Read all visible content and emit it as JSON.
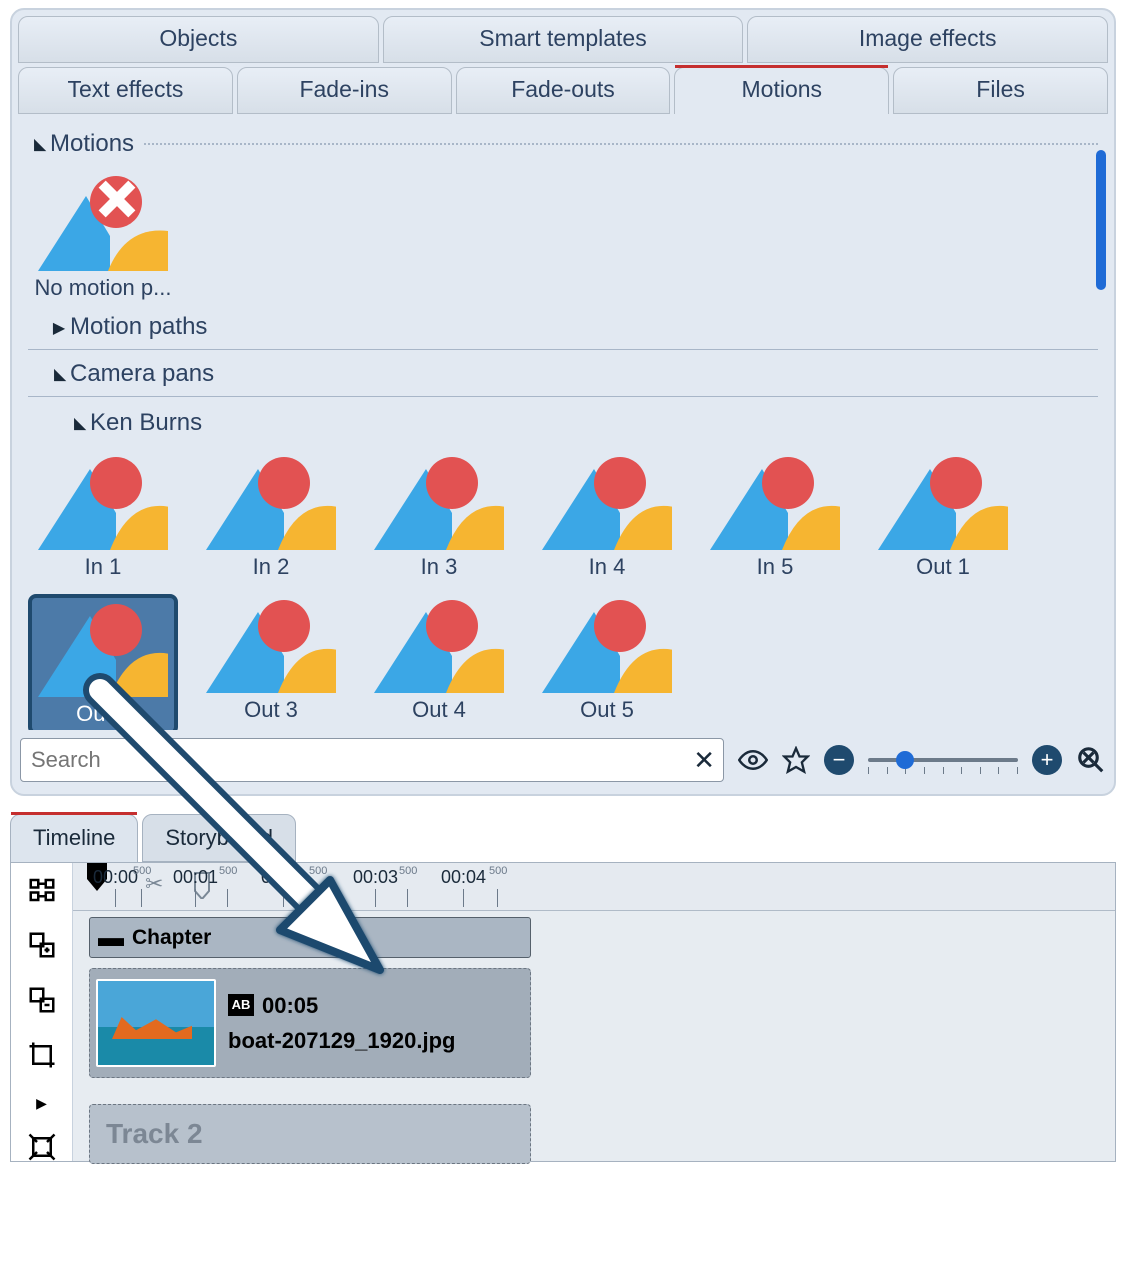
{
  "top_tabs_row1": [
    "Objects",
    "Smart templates",
    "Image effects"
  ],
  "top_tabs_row2": [
    "Text effects",
    "Fade-ins",
    "Fade-outs",
    "Motions",
    "Files"
  ],
  "active_tab_row2_index": 3,
  "sections": {
    "motions": {
      "label": "Motions",
      "expanded": true
    },
    "no_motion": {
      "label": "No motion p..."
    },
    "motion_paths": {
      "label": "Motion paths",
      "expanded": false
    },
    "camera_pans": {
      "label": "Camera pans",
      "expanded": true
    },
    "ken_burns": {
      "label": "Ken Burns",
      "expanded": true
    }
  },
  "ken_burns_items": [
    "In 1",
    "In 2",
    "In 3",
    "In 4",
    "In 5",
    "Out 1",
    "Out 2",
    "Out 3",
    "Out 4",
    "Out 5"
  ],
  "selected_item": "Out 2",
  "search": {
    "placeholder": "Search",
    "value": ""
  },
  "lower_tabs": [
    "Timeline",
    "Storyboard"
  ],
  "active_lower_tab_index": 0,
  "ruler_labels": [
    {
      "text": "00:00",
      "pos": 20
    },
    {
      "text": "500",
      "pos": 60,
      "minor": true
    },
    {
      "text": "00:01",
      "pos": 100
    },
    {
      "text": "500",
      "pos": 146,
      "minor": true
    },
    {
      "text": "00:02",
      "pos": 188
    },
    {
      "text": "500",
      "pos": 236,
      "minor": true
    },
    {
      "text": "00:03",
      "pos": 280
    },
    {
      "text": "500",
      "pos": 326,
      "minor": true
    },
    {
      "text": "00:04",
      "pos": 368
    },
    {
      "text": "500",
      "pos": 416,
      "minor": true
    }
  ],
  "chapter_label": "Chapter",
  "clip": {
    "duration": "00:05",
    "filename": "boat-207129_1920.jpg",
    "ab": "AB"
  },
  "track2_label": "Track 2"
}
